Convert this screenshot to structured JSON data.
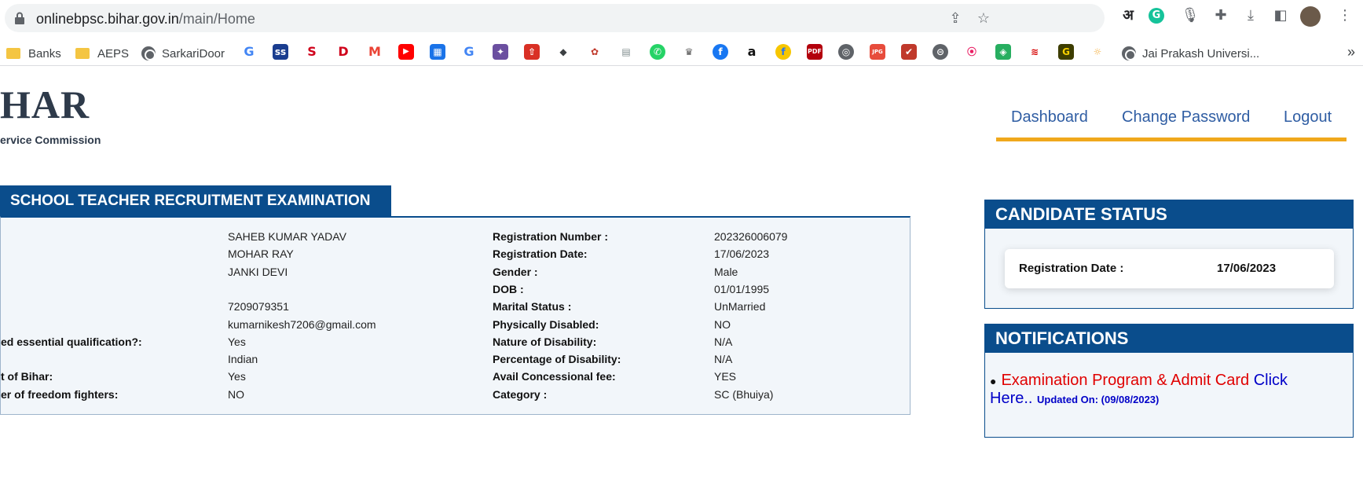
{
  "browser": {
    "url_host": "onlinebpsc.bihar.gov.in",
    "url_path": "/main/Home",
    "bookmarks": [
      "Banks",
      "AEPS",
      "SarkariDoor",
      "Jai Prakash Universi..."
    ]
  },
  "logo": {
    "text": "HAR",
    "subtitle": "ervice Commission"
  },
  "nav": {
    "dashboard": "Dashboard",
    "change_password": "Change Password",
    "logout": "Logout"
  },
  "exam": {
    "title": "SCHOOL TEACHER RECRUITMENT EXAMINATION",
    "left_labels": [
      "",
      "",
      "",
      "",
      "",
      "",
      "ed essential qualification?:",
      "",
      "t of Bihar:",
      "er of freedom fighters:"
    ],
    "left_values": [
      "SAHEB KUMAR YADAV",
      "MOHAR RAY",
      "JANKI DEVI",
      "",
      "7209079351",
      "kumarnikesh7206@gmail.com",
      "Yes",
      "Indian",
      "Yes",
      "NO"
    ],
    "right_labels": [
      "Registration Number :",
      "Registration Date:",
      "Gender :",
      "DOB :",
      "Marital Status :",
      "Physically Disabled:",
      "Nature of Disability:",
      "Percentage of Disability:",
      "Avail Concessional fee:",
      "Category :"
    ],
    "right_values": [
      "202326006079",
      "17/06/2023",
      "Male",
      "01/01/1995",
      "UnMarried",
      "NO",
      "N/A",
      "N/A",
      "YES",
      "SC (Bhuiya)"
    ]
  },
  "candidate_status": {
    "title": "CANDIDATE STATUS",
    "reg_date_label": "Registration Date :",
    "reg_date_value": "17/06/2023"
  },
  "notifications": {
    "title": "NOTIFICATIONS",
    "item_text": "Examination Program & Admit Card",
    "click_1": "Click",
    "click_2": "Here..",
    "updated": "Updated On: (09/08/2023)"
  },
  "colors": {
    "primary": "#0a4d8c",
    "accent": "#f0a81c",
    "nav_link": "#2f5da3",
    "notif_red": "#e00000"
  }
}
